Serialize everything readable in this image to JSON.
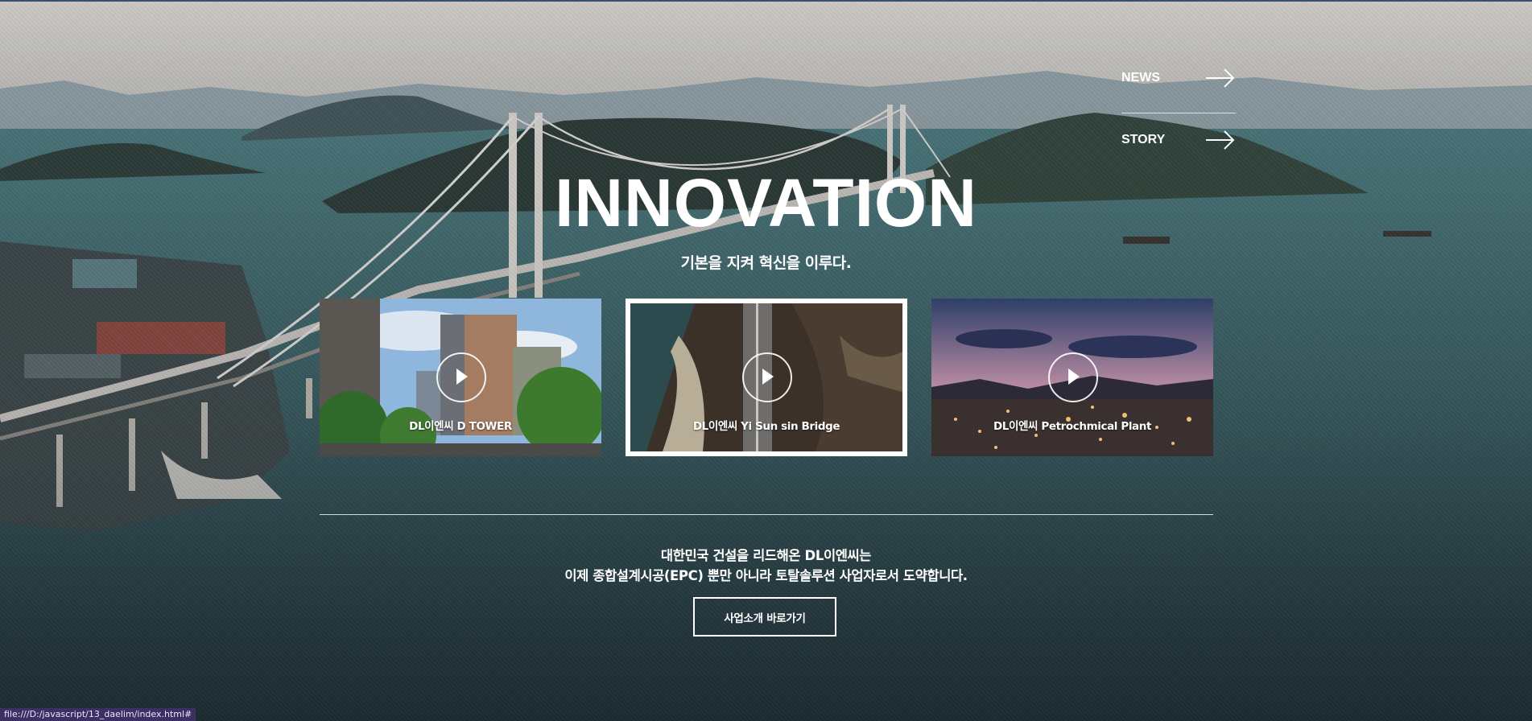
{
  "side_links": [
    {
      "label": "NEWS",
      "icon": "arrow-right-icon"
    },
    {
      "label": "STORY",
      "icon": "arrow-right-icon"
    }
  ],
  "hero": {
    "title": "INNOVATION",
    "subtitle": "기본을 지켜 혁신을 이루다."
  },
  "videos": [
    {
      "label": "DL이엔씨 D TOWER",
      "icon": "play-icon",
      "selected": false
    },
    {
      "label": "DL이엔씨 Yi Sun sin Bridge",
      "icon": "play-icon",
      "selected": true
    },
    {
      "label": "DL이엔씨 Petrochmical Plant",
      "icon": "play-icon",
      "selected": false
    }
  ],
  "description": {
    "line1": "대한민국 건설을 리드해온 DL이엔씨는",
    "line2": "이제 종합설계시공(EPC) 뿐만 아니라 토탈솔루션 사업자로서 도약합니다."
  },
  "cta_label": "사업소개 바로가기",
  "status_url": "file:///D:/javascript/13_daelim/index.html#",
  "colors": {
    "water": "#3c6468",
    "sky": "#d9d6d2",
    "status_bg": "#3b2f63"
  }
}
